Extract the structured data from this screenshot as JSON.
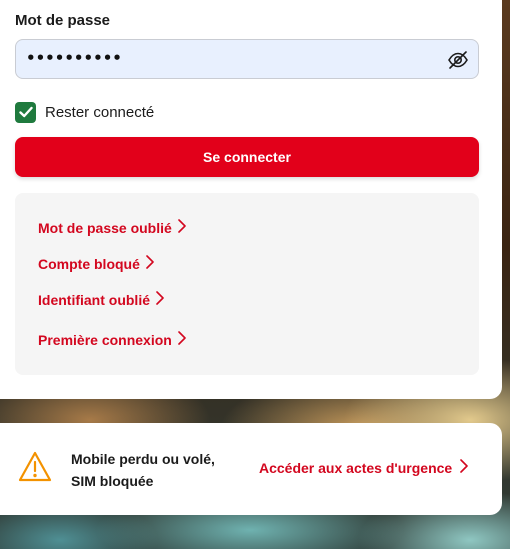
{
  "login": {
    "password_label": "Mot de passe",
    "password_value": "••••••••••",
    "eye_icon": "eye-slash-icon",
    "remember_label": "Rester connecté",
    "remember_checked": true,
    "submit_label": "Se connecter"
  },
  "help_links": [
    {
      "label": "Mot de passe oublié"
    },
    {
      "label": "Compte bloqué"
    },
    {
      "label": "Identifiant oublié"
    },
    {
      "label": "Première connexion"
    }
  ],
  "urgent": {
    "icon": "warning-triangle-icon",
    "line1": "Mobile perdu ou volé,",
    "line2": "SIM bloquée",
    "link_label": "Accéder aux actes d'urgence"
  },
  "colors": {
    "brand_red": "#e2001a",
    "link_red": "#d3071f",
    "check_green": "#1f7a3e",
    "warning_orange": "#f39200",
    "field_bg": "#e8f0fe"
  }
}
